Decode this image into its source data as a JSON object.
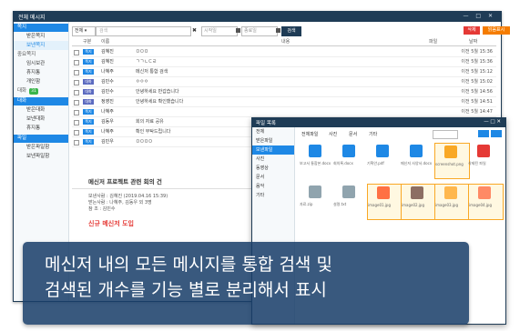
{
  "main_window": {
    "title": "전체 메시지",
    "controls": "— □ ✕",
    "sidebar": {
      "section1": "쪽지",
      "items1": [
        "받은쪽지",
        "보낸쪽지",
        "중요쪽지",
        "임시보관",
        "휴지통",
        "개인함"
      ],
      "badge": "31",
      "section2": "대화",
      "items2": [
        "받은대화",
        "보낸대화",
        "휴지통"
      ],
      "section3": "파일",
      "items3": [
        "받은파일함",
        "보낸파일함"
      ]
    },
    "toolbar": {
      "select": "전체 ▾",
      "search_placeholder": "검색",
      "date_from": "시작일",
      "date_to": "종료일",
      "search_button": "검색",
      "btn_delete": "삭제",
      "btn_read": "읽음표시"
    },
    "columns": [
      "구분",
      "이름",
      "내용",
      "파일",
      "날짜"
    ],
    "rows": [
      {
        "tag": "쪽지",
        "color": "#1e88e5",
        "from": "김혜진",
        "subject": "ㅁㅁㅁ",
        "time": "이전 5월 15:36"
      },
      {
        "tag": "쪽지",
        "color": "#1e88e5",
        "from": "김혜진",
        "subject": "ㄱㄱㄴㄷㄹ",
        "time": "이전 5월 15:36"
      },
      {
        "tag": "쪽지",
        "color": "#1e88e5",
        "from": "나혜주",
        "subject": "메신저 통합 검색",
        "time": "이전 5월 15:12"
      },
      {
        "tag": "대화",
        "color": "#5c6bc0",
        "from": "김민수",
        "subject": "ㅇㅇㅇ",
        "time": "이전 5월 15:02"
      },
      {
        "tag": "대화",
        "color": "#5c6bc0",
        "from": "김민수",
        "subject": "안녕하세요 반갑습니다",
        "time": "이전 5월 14:56"
      },
      {
        "tag": "대화",
        "color": "#5c6bc0",
        "from": "정영진",
        "subject": "안녕하세요 확인했습니다",
        "time": "이전 5월 14:51"
      },
      {
        "tag": "쪽지",
        "color": "#1e88e5",
        "from": "나혜주",
        "subject": "",
        "time": "이전 5월 14:47"
      },
      {
        "tag": "쪽지",
        "color": "#1e88e5",
        "from": "김동우",
        "subject": "회의 자료 공유",
        "time": "이전 4월 16:12"
      },
      {
        "tag": "쪽지",
        "color": "#1e88e5",
        "from": "나혜주",
        "subject": "확인 부탁드립니다",
        "time": "이전 4월 15:47"
      },
      {
        "tag": "쪽지",
        "color": "#1e88e5",
        "from": "김민우",
        "subject": "ㅁㅁㅁㅁ",
        "time": "이전 4월 15:06"
      }
    ],
    "preview": {
      "title": "메신저 프로젝트 관련 회의 건",
      "line1": "보낸사람 : 김혜진 (2019.04.16 15:39)",
      "line2": "받는사람 : 나혜주, 김동우 외 3명",
      "line3": "참   조 : 김민수",
      "highlight": "신규 메신저 도입"
    }
  },
  "file_window": {
    "title": "파일 목록",
    "side_items": [
      "전체",
      "받은파일",
      "보낸파일",
      "사진",
      "동영상",
      "문서",
      "음악",
      "기타"
    ],
    "tabs": [
      "전체파일",
      "사진",
      "문서",
      "기타"
    ],
    "tiles": [
      {
        "cap": "보고서 통합본.docx",
        "color": "#1e88e5",
        "hl": false
      },
      {
        "cap": "회의록.docx",
        "color": "#1e88e5",
        "hl": false
      },
      {
        "cap": "기획안.pdf",
        "color": "#1e88e5",
        "hl": false
      },
      {
        "cap": "메신저 사양서.docx",
        "color": "#1e88e5",
        "hl": false
      },
      {
        "cap": "screenshot.png",
        "color": "#f9a825",
        "hl": true
      },
      {
        "cap": "삭제된 파일",
        "color": "#e53935",
        "hl": false
      },
      {
        "cap": "자료.zip",
        "color": "#90a4ae",
        "hl": false
      },
      {
        "cap": "설명.txt",
        "color": "#90a4ae",
        "hl": false
      },
      {
        "cap": "image01.jpg",
        "color": "#ff7043",
        "hl": true
      },
      {
        "cap": "image02.jpg",
        "color": "#8d6e63",
        "hl": true
      },
      {
        "cap": "image03.jpg",
        "color": "#ffb74d",
        "hl": true
      },
      {
        "cap": "image04.jpg",
        "color": "#ff8a65",
        "hl": true
      }
    ]
  },
  "overlay": {
    "line1": "메신저 내의 모든 메시지를 통합 검색 및",
    "line2": "검색된 개수를 기능 별로 분리해서 표시"
  }
}
